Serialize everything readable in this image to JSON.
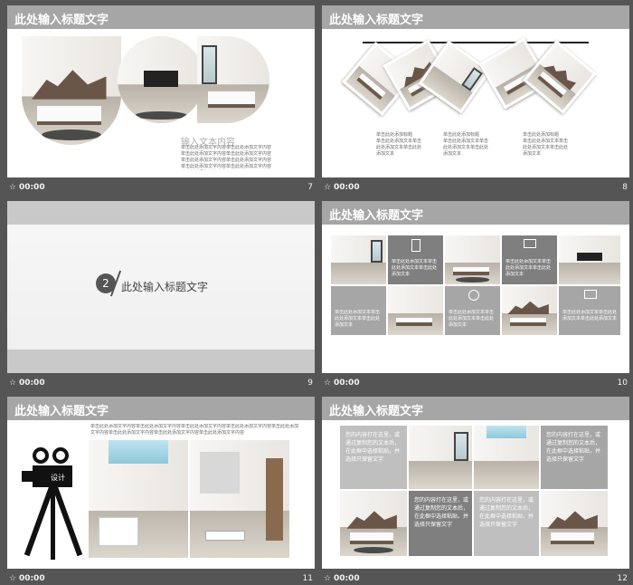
{
  "slides": [
    {
      "num": "7",
      "time": "00:00",
      "title": "此处输入标题文字",
      "subtitle": "输入文本内容",
      "body": "单击此处添加文字内容单击此处添加文字内容单击此处添加文字内容单击此处添加文字内容单击此处添加文字内容单击此处添加文字内容单击此处添加文字内容单击此处添加文字内容单击此处添加文字内容"
    },
    {
      "num": "8",
      "time": "00:00",
      "title": "此处输入标题文字",
      "captions": [
        {
          "head": "单击此处添加标题",
          "body": "单击此处添加文本单击此处添加文本单击此处添加文本"
        },
        {
          "head": "单击此处添加标题",
          "body": "单击此处添加文本单击此处添加文本单击此处添加文本"
        },
        {
          "head": "单击此处添加标题",
          "body": "单击此处添加文本单击此处添加文本单击此处添加文本"
        }
      ]
    },
    {
      "num": "9",
      "time": "00:00",
      "section_number": "2",
      "section_title": "此处输入标题文字"
    },
    {
      "num": "10",
      "time": "00:00",
      "title": "此处输入标题文字",
      "tiles": [
        "单击此处添加文本单击此处添加文本单击此处添加文本",
        "单击此处添加文本单击此处添加文本单击此处添加文本",
        "单击此处添加文本单击此处添加文本单击此处添加文本",
        "单击此处添加文本单击此处添加文本单击此处添加文本",
        "单击此处添加文本单击此处添加文本单击此处添加文本"
      ]
    },
    {
      "num": "11",
      "time": "00:00",
      "title": "此处输入标题文字",
      "body": "单击此处添加文字内容单击此处添加文字内容单击此处添加文字内容单击此处添加文字内容单击此处添加文字内容单击此处添加文字内容单击此处添加文字内容单击此处添加文字内容",
      "icon_caption": "设计"
    },
    {
      "num": "12",
      "time": "00:00",
      "title": "此处输入标题文字",
      "tiles": [
        "您的内容打在这里，或通过复制您的文本后，在此框中选择粘贴，并选择只保留文字",
        "您的内容打在这里，或通过复制您的文本后，在此框中选择粘贴，并选择只保留文字",
        "您的内容打在这里，或通过复制您的文本后，在此框中选择粘贴，并选择只保留文字",
        "您的内容打在这里，或通过复制您的文本后，在此框中选择粘贴，并选择只保留文字"
      ]
    }
  ]
}
